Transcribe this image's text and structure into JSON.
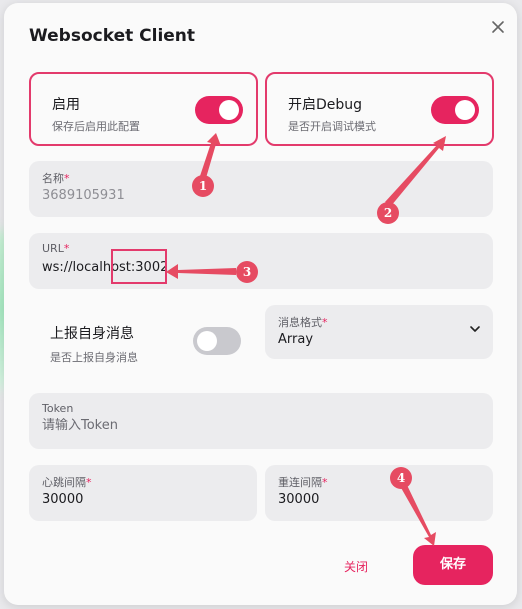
{
  "dialog": {
    "title": "Websocket Client"
  },
  "enable": {
    "label": "启用",
    "desc": "保存后启用此配置",
    "on": true
  },
  "debug": {
    "label": "开启Debug",
    "desc": "是否开启调试模式",
    "on": true
  },
  "name_field": {
    "label": "名称",
    "value": "3689105931"
  },
  "url_field": {
    "label": "URL",
    "value": "ws://localhost:3002"
  },
  "report_self": {
    "label": "上报自身消息",
    "desc": "是否上报自身消息",
    "on": false
  },
  "message_format": {
    "label": "消息格式",
    "value": "Array"
  },
  "token_field": {
    "label": "Token",
    "placeholder": "请输入Token"
  },
  "heartbeat": {
    "label": "心跳间隔",
    "value": "30000"
  },
  "reconnect": {
    "label": "重连间隔",
    "value": "30000"
  },
  "buttons": {
    "close": "关闭",
    "save": "保存"
  },
  "annotations": [
    "1",
    "2",
    "3",
    "4"
  ],
  "colors": {
    "accent": "#e6245f",
    "highlight": "#e33a6c",
    "annotation": "#e64b62"
  }
}
